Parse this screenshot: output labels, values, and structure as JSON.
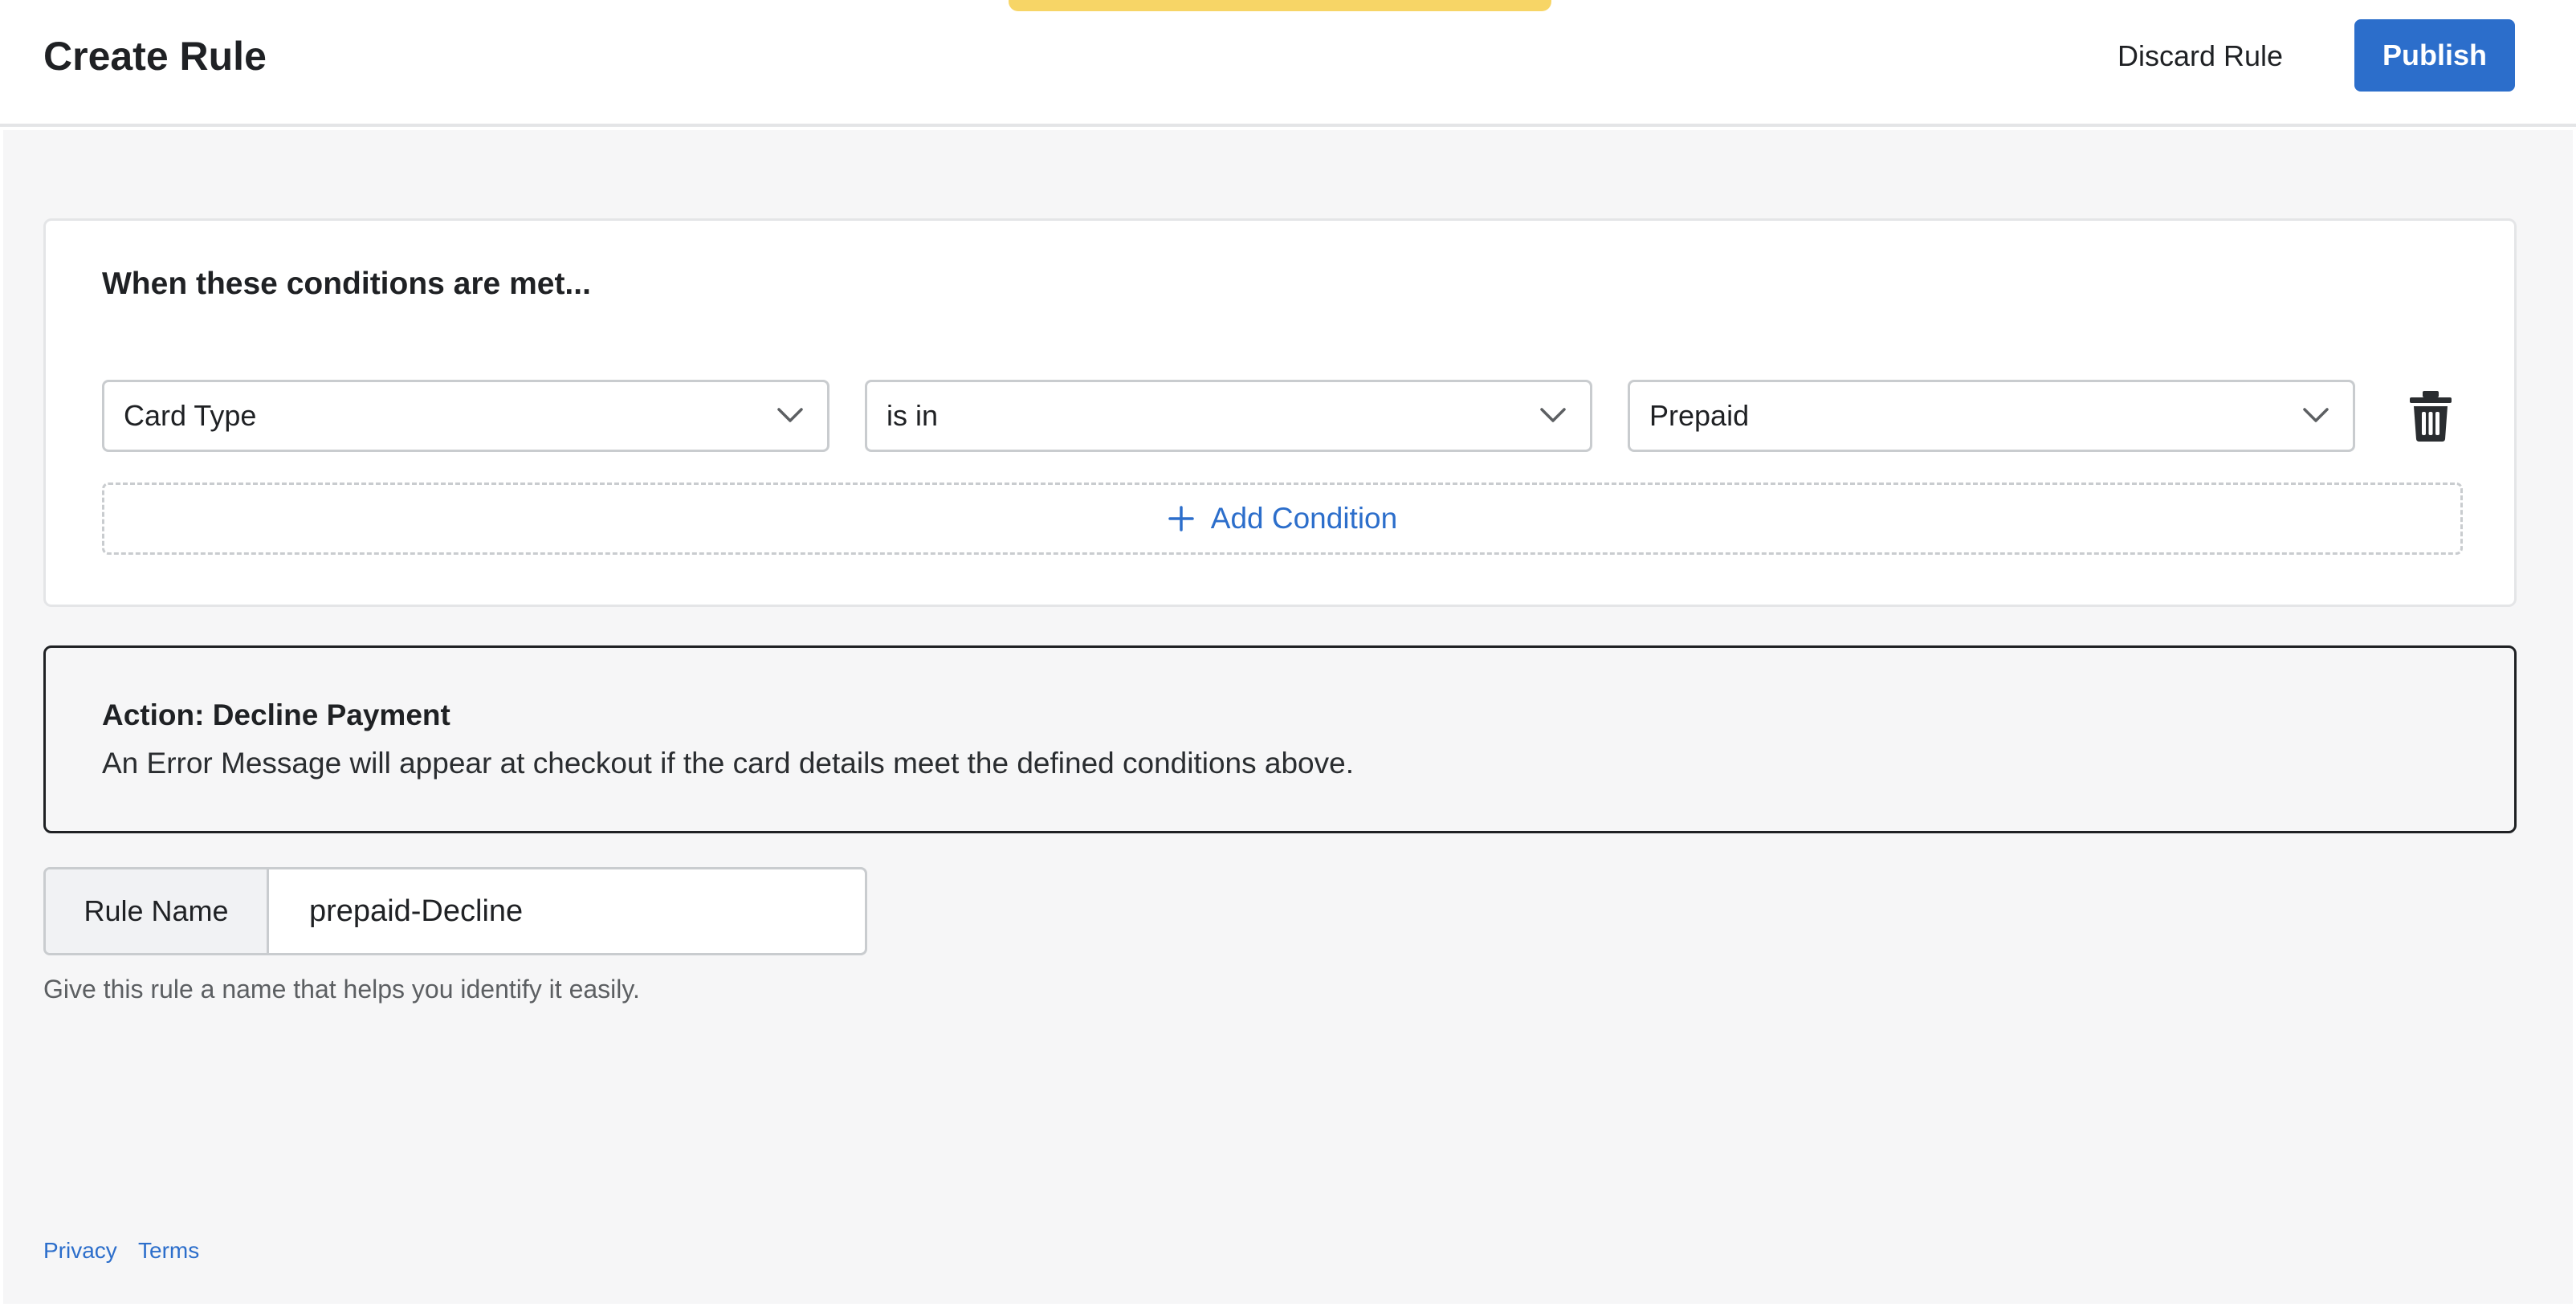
{
  "header": {
    "title": "Create Rule",
    "discard_label": "Discard Rule",
    "publish_label": "Publish"
  },
  "colors": {
    "primary": "#2c6ecb",
    "indicator": "#f7d566",
    "background": "#f6f6f7"
  },
  "conditions": {
    "heading": "When these conditions are met...",
    "rows": [
      {
        "field": "Card Type",
        "operator": "is in",
        "value": "Prepaid"
      }
    ],
    "add_label": "Add Condition"
  },
  "action": {
    "title": "Action: Decline Payment",
    "description": "An Error Message will appear at checkout if the card details meet the defined conditions above."
  },
  "rule_name": {
    "label": "Rule Name",
    "value": "prepaid-Decline",
    "help": "Give this rule a name that helps you identify it easily."
  },
  "footer": {
    "privacy": "Privacy",
    "terms": "Terms"
  },
  "icons": {
    "delete": "trash-icon",
    "dropdown": "chevron-down-icon",
    "add": "plus-icon"
  }
}
